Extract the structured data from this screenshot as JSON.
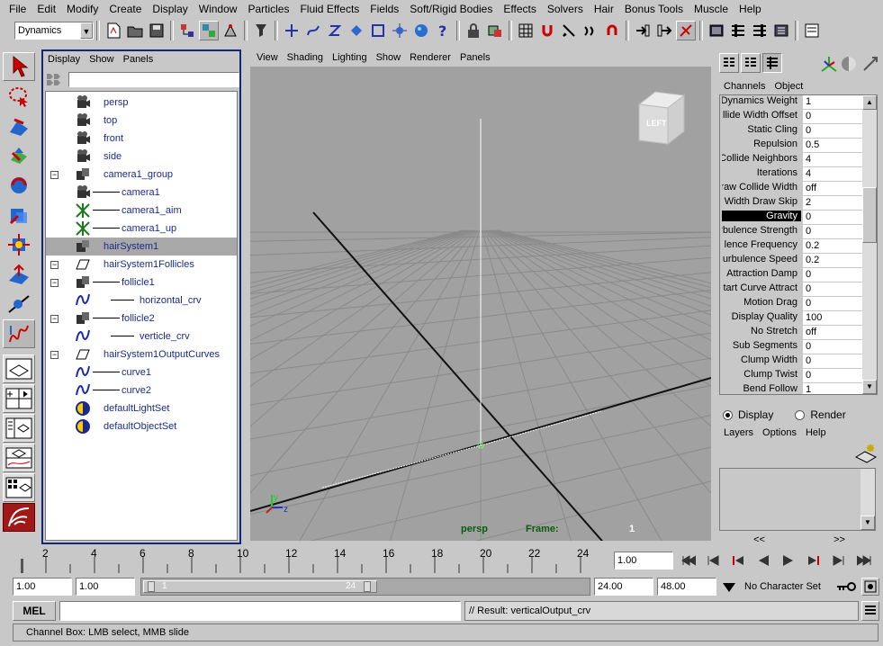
{
  "menubar": [
    "File",
    "Edit",
    "Modify",
    "Create",
    "Display",
    "Window",
    "Particles",
    "Fluid Effects",
    "Fields",
    "Soft/Rigid Bodies",
    "Effects",
    "Solvers",
    "Hair",
    "Bonus Tools",
    "Muscle",
    "Help"
  ],
  "toolbar": {
    "menuset": "Dynamics"
  },
  "outliner": {
    "menu": [
      "Display",
      "Show",
      "Panels"
    ],
    "items": [
      {
        "label": "persp",
        "indent": 0,
        "icon": "camera-icon",
        "expand": ""
      },
      {
        "label": "top",
        "indent": 0,
        "icon": "camera-icon",
        "expand": ""
      },
      {
        "label": "front",
        "indent": 0,
        "icon": "camera-icon",
        "expand": ""
      },
      {
        "label": "side",
        "indent": 0,
        "icon": "camera-icon",
        "expand": ""
      },
      {
        "label": "camera1_group",
        "indent": 0,
        "icon": "group-icon",
        "expand": "−"
      },
      {
        "label": "camera1",
        "indent": 1,
        "icon": "camera-icon",
        "expand": ""
      },
      {
        "label": "camera1_aim",
        "indent": 1,
        "icon": "locator-icon",
        "expand": ""
      },
      {
        "label": "camera1_up",
        "indent": 1,
        "icon": "locator-icon",
        "expand": ""
      },
      {
        "label": "hairSystem1",
        "indent": 0,
        "icon": "hair-system-icon",
        "expand": "",
        "selected": true
      },
      {
        "label": "hairSystem1Follicles",
        "indent": 0,
        "icon": "transform-icon",
        "expand": "−"
      },
      {
        "label": "follicle1",
        "indent": 1,
        "icon": "follicle-icon",
        "expand": "−"
      },
      {
        "label": "horizontal_crv",
        "indent": 2,
        "icon": "curve-icon",
        "expand": ""
      },
      {
        "label": "follicle2",
        "indent": 1,
        "icon": "follicle-icon",
        "expand": "−"
      },
      {
        "label": "verticle_crv",
        "indent": 2,
        "icon": "curve-icon",
        "expand": ""
      },
      {
        "label": "hairSystem1OutputCurves",
        "indent": 0,
        "icon": "transform-icon",
        "expand": "−"
      },
      {
        "label": "curve1",
        "indent": 1,
        "icon": "curve-icon",
        "expand": ""
      },
      {
        "label": "curve2",
        "indent": 1,
        "icon": "curve-icon",
        "expand": ""
      },
      {
        "label": "defaultLightSet",
        "indent": 0,
        "icon": "set-icon",
        "expand": ""
      },
      {
        "label": "defaultObjectSet",
        "indent": 0,
        "icon": "set-icon",
        "expand": ""
      }
    ]
  },
  "viewport": {
    "menu": [
      "View",
      "Shading",
      "Lighting",
      "Show",
      "Renderer",
      "Panels"
    ],
    "camera": "persp",
    "frame_label": "Frame:",
    "frame_value": "1",
    "cube_label": "LEFT",
    "axis_y": "y",
    "axis_z": "z"
  },
  "channelbox": {
    "menu": [
      "Channels",
      "Object"
    ],
    "channels": [
      {
        "name": "Dynamics Weight",
        "value": "1"
      },
      {
        "name": "llide Width Offset",
        "value": "0"
      },
      {
        "name": "Static Cling",
        "value": "0"
      },
      {
        "name": "Repulsion",
        "value": "0.5"
      },
      {
        "name": "Collide Neighbors",
        "value": "4"
      },
      {
        "name": "Iterations",
        "value": "4"
      },
      {
        "name": "raw Collide Width",
        "value": "off"
      },
      {
        "name": "Width Draw Skip",
        "value": "2"
      },
      {
        "name": "Gravity",
        "value": "0",
        "selected": true
      },
      {
        "name": "rbulence Strength",
        "value": "0"
      },
      {
        "name": "lence Frequency",
        "value": "0.2"
      },
      {
        "name": "urbulence Speed",
        "value": "0.2"
      },
      {
        "name": "Attraction Damp",
        "value": "0"
      },
      {
        "name": "tart Curve Attract",
        "value": "0"
      },
      {
        "name": "Motion Drag",
        "value": "0"
      },
      {
        "name": "Display Quality",
        "value": "100"
      },
      {
        "name": "No Stretch",
        "value": "off"
      },
      {
        "name": "Sub Segments",
        "value": "0"
      },
      {
        "name": "Clump Width",
        "value": "0"
      },
      {
        "name": "Clump Twist",
        "value": "0"
      },
      {
        "name": "Bend Follow",
        "value": "1"
      }
    ]
  },
  "layers": {
    "display_label": "Display",
    "render_label": "Render",
    "menu": [
      "Layers",
      "Options",
      "Help"
    ],
    "scroll_left": "<<",
    "scroll_right": ">>"
  },
  "timeline": {
    "ticks": [
      "2",
      "4",
      "6",
      "8",
      "10",
      "12",
      "14",
      "16",
      "18",
      "20",
      "22",
      "24"
    ],
    "current_time": "1.00"
  },
  "range": {
    "start": "1.00",
    "playback_start": "1.00",
    "slider_start": "1",
    "slider_end": "24",
    "playback_end": "24.00",
    "end": "48.00",
    "character_set": "No Character Set"
  },
  "command": {
    "lang": "MEL",
    "result": "// Result: verticalOutput_crv"
  },
  "helpline": {
    "text": "Channel Box: LMB select, MMB slide"
  }
}
